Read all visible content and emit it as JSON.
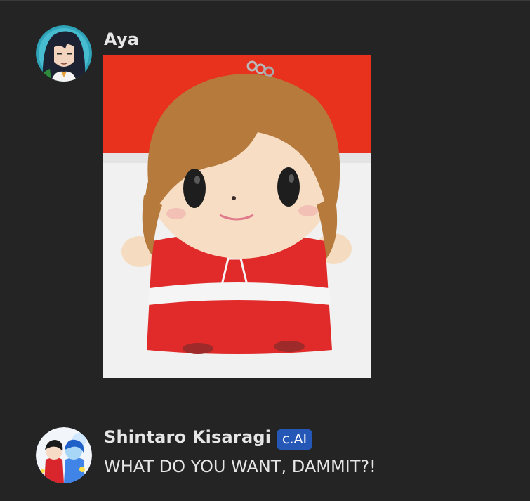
{
  "messages": [
    {
      "author": "Aya",
      "avatar_icon": "avatar-aya-icon",
      "attachment": {
        "type": "image",
        "subject": "plush-doll-image",
        "colors": {
          "background_top": "#e8321e",
          "background_bottom": "#f2f2f2",
          "hair": "#b57a3c",
          "skin": "#f7dfc6",
          "dress": "#e02a2a"
        }
      }
    },
    {
      "author": "Shintaro Kisaragi",
      "badge": "c.AI",
      "avatar_icon": "avatar-shintaro-icon",
      "text": "WHAT DO YOU WANT, DAMMIT?!"
    }
  ],
  "colors": {
    "background": "#242424",
    "text": "#e6e6e6",
    "badge": "#2557b7"
  }
}
